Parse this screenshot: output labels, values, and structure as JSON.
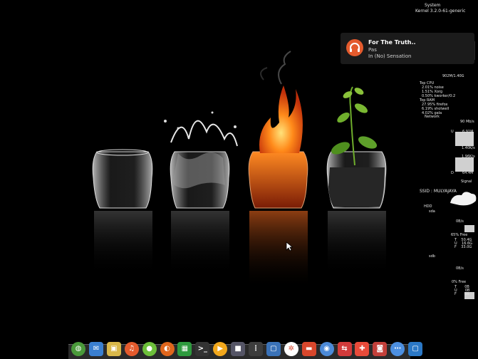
{
  "system": {
    "title": "System",
    "kernel": "Kernel 3.2.0-61-generic"
  },
  "notification": {
    "title": "For The Truth..",
    "artist": "Pas",
    "album": "In (No) Sensation",
    "icon": "headphones-icon"
  },
  "conky": {
    "mem_summary": "902M/1.40G",
    "top_cpu_label": "Top CPU",
    "top_cpu": [
      {
        "pct": "2.01%",
        "name": "noise"
      },
      {
        "pct": "1.51%",
        "name": "Xorg"
      },
      {
        "pct": "0.50%",
        "name": "kworker/0:2"
      }
    ],
    "top_ram_label": "Top RAM",
    "top_ram": [
      {
        "pct": "27.95%",
        "name": "firefox"
      },
      {
        "pct": "6.19%",
        "name": "shotwell"
      },
      {
        "pct": "4.02%",
        "name": "gala"
      }
    ],
    "network_label": "Network",
    "network_speed": "90 Mb/s",
    "up_label": "U",
    "up_value": "6.91M",
    "up_rate": "1.40K/s",
    "down_rate": "1.96K/s",
    "down_label": "D",
    "down_value": "64.4M",
    "signal_label": "Signal",
    "ssid": "SSID : MULYAJAYA",
    "hdd_label": "HDD",
    "sda_label": "sda",
    "sda_rate": "0B/s",
    "sda_free": "65% Free",
    "sda_rows": [
      {
        "k": "T",
        "v": "50.4G"
      },
      {
        "k": "U",
        "v": "16.6G"
      },
      {
        "k": "F",
        "v": "33.0G"
      }
    ],
    "sdb_label": "sdb",
    "sdb_rate": "0B/s",
    "sdb_free": "0% Free",
    "sdb_rows": [
      {
        "k": "T",
        "v": "0B"
      },
      {
        "k": "U",
        "v": "0B"
      },
      {
        "k": "F",
        "v": "0B"
      }
    ]
  },
  "dock": {
    "items": [
      {
        "name": "web-browser-icon",
        "color": "#4a9a3a"
      },
      {
        "name": "mail-icon",
        "color": "#3a7fd0"
      },
      {
        "name": "photos-icon",
        "color": "#d9b84a"
      },
      {
        "name": "music-icon",
        "color": "#e45b2d"
      },
      {
        "name": "app-center-icon",
        "color": "#6dbf3a"
      },
      {
        "name": "firefox-icon",
        "color": "#e0661c"
      },
      {
        "name": "spreadsheet-icon",
        "color": "#2e9a3e"
      },
      {
        "name": "terminal-icon",
        "color": "#333333"
      },
      {
        "name": "media-player-icon",
        "color": "#f2a81c"
      },
      {
        "name": "video-icon",
        "color": "#555566"
      },
      {
        "name": "apps-grid-icon",
        "color": "#3d3d3d"
      },
      {
        "name": "virtualbox-icon",
        "color": "#3a72b8"
      },
      {
        "name": "pinwheel-icon",
        "color": "#ffffff"
      },
      {
        "name": "files-icon",
        "color": "#d8472c"
      },
      {
        "name": "chromium-icon",
        "color": "#4c8ad8"
      },
      {
        "name": "switcher-icon",
        "color": "#d23b3b"
      },
      {
        "name": "software-store-icon",
        "color": "#e84b3a"
      },
      {
        "name": "camera-icon",
        "color": "#c3403a"
      },
      {
        "name": "chat-icon",
        "color": "#4c8fe0"
      },
      {
        "name": "screenshot-icon",
        "color": "#2b78c6"
      }
    ]
  }
}
